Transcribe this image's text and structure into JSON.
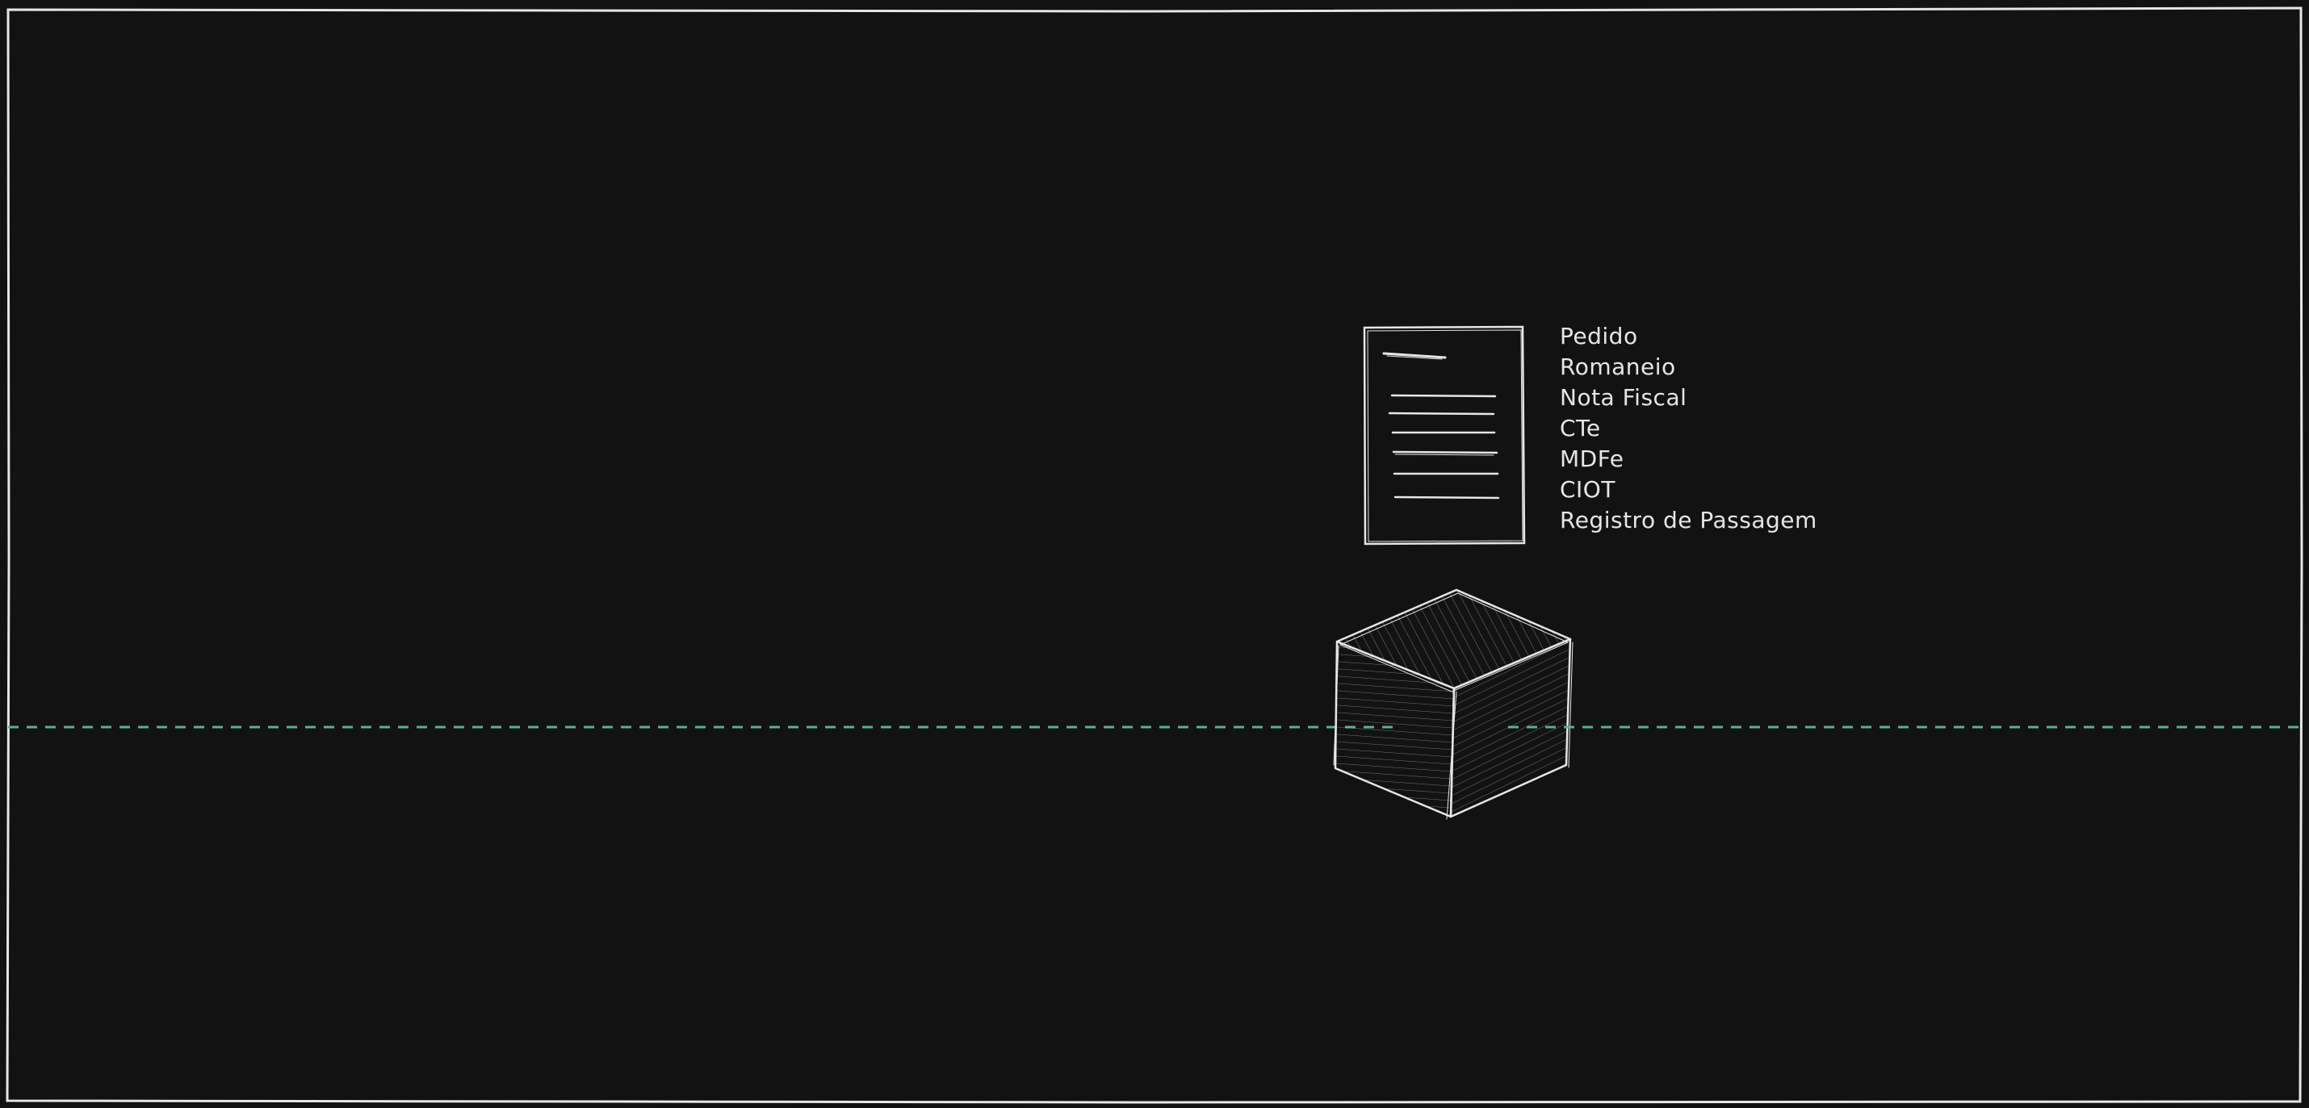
{
  "diagram": {
    "documents": [
      {
        "label": "Pedido"
      },
      {
        "label": "Romaneio"
      },
      {
        "label": "Nota Fiscal"
      },
      {
        "label": "CTe"
      },
      {
        "label": "MDFe"
      },
      {
        "label": "CIOT"
      },
      {
        "label": "Registro de Passagem"
      }
    ]
  },
  "colors": {
    "background": "#121212",
    "stroke": "#e6e6e6",
    "route": "#4fb3a0"
  },
  "icons": {
    "document": "document-icon",
    "package": "package-box-icon"
  }
}
